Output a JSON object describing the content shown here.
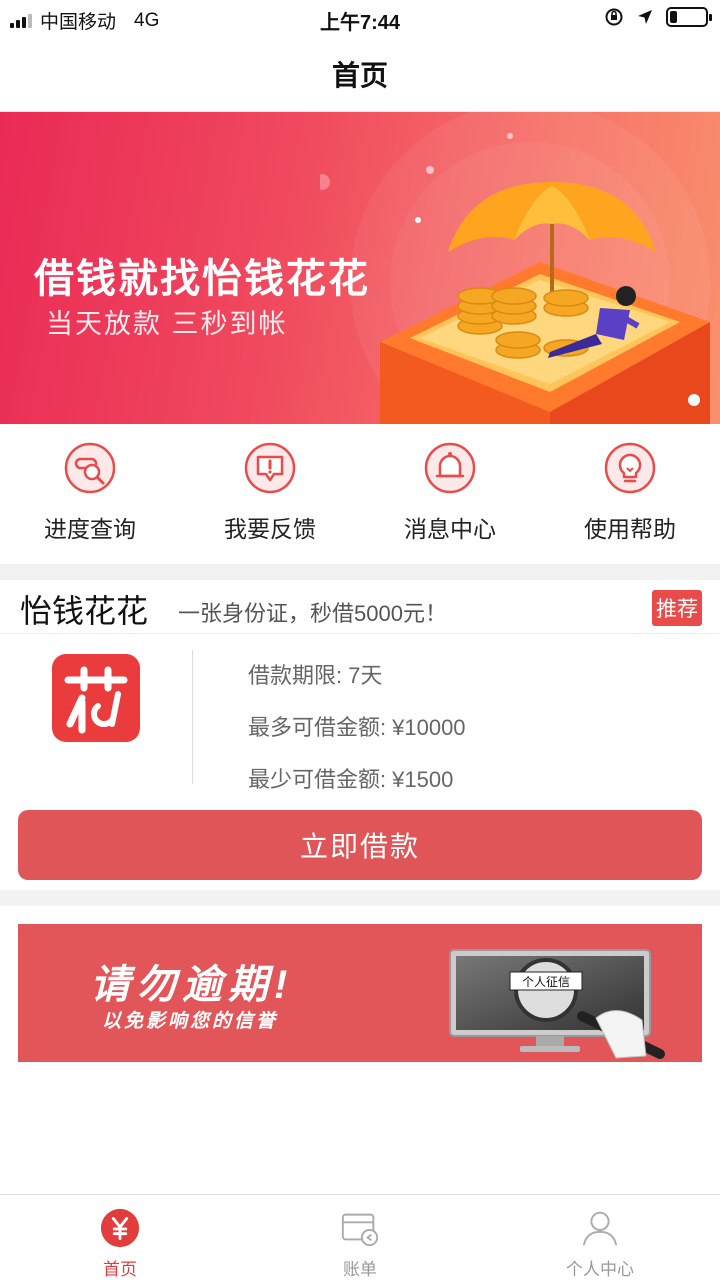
{
  "status_bar": {
    "carrier": "中国移动",
    "network": "4G",
    "time": "上午7:44",
    "battery_level": 0.2
  },
  "nav": {
    "title": "首页"
  },
  "banner": {
    "title": "借钱就找怡钱花花",
    "subtitle": "当天放款 三秒到帐"
  },
  "quick_actions": [
    {
      "label": "进度查询",
      "icon": "search-progress-icon"
    },
    {
      "label": "我要反馈",
      "icon": "feedback-icon"
    },
    {
      "label": "消息中心",
      "icon": "bell-icon"
    },
    {
      "label": "使用帮助",
      "icon": "lightbulb-icon"
    }
  ],
  "product": {
    "name": "怡钱花花",
    "slogan": "一张身份证，秒借5000元！",
    "tag": "推荐",
    "term_label": "借款期限:",
    "term_value": "7天",
    "max_label": "最多可借金额:",
    "max_value": "¥10000",
    "min_label": "最少可借金额:",
    "min_value": "¥1500",
    "button": "立即借款"
  },
  "ad": {
    "title": "请勿逾期!",
    "subtitle": "以免影响您的信誉",
    "image_text": "个人征信"
  },
  "tabs": [
    {
      "label": "首页",
      "icon": "yuan-icon",
      "active": true
    },
    {
      "label": "账单",
      "icon": "bill-icon",
      "active": false
    },
    {
      "label": "个人中心",
      "icon": "user-icon",
      "active": false
    }
  ],
  "colors": {
    "accent": "#e94b4b",
    "button": "#e05658",
    "tab_active": "#e23d3d"
  }
}
